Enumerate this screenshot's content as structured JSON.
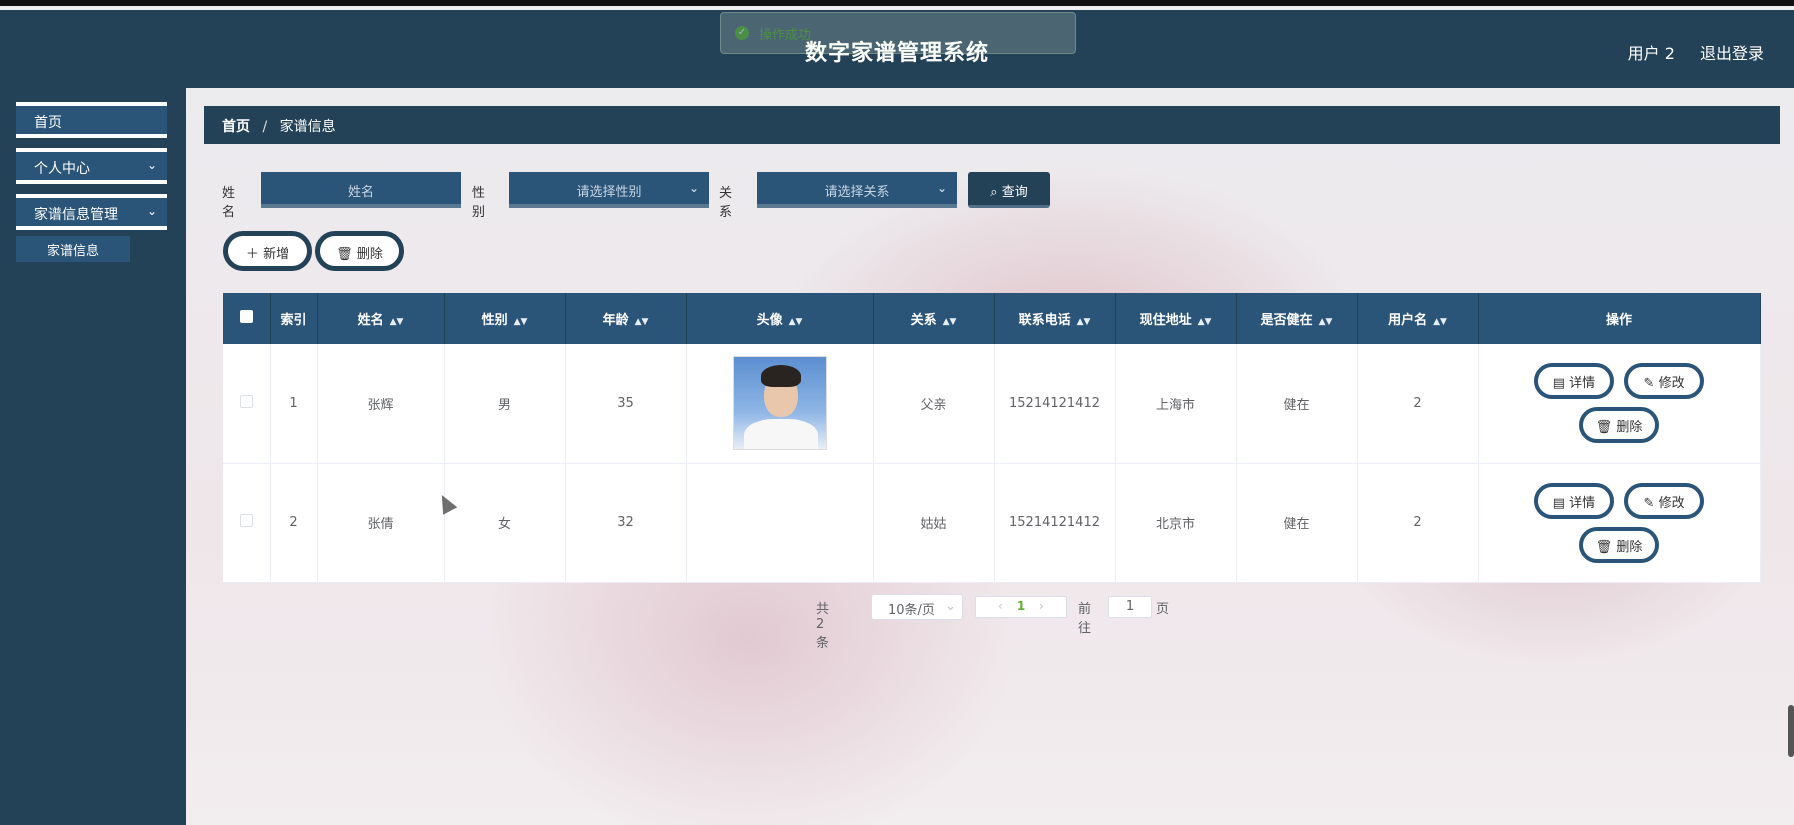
{
  "app_title": "数字家谱管理系统",
  "header_user": "用户 2",
  "header_logout": "退出登录",
  "toast": "操作成功",
  "sidebar": {
    "items": [
      {
        "label": "首页"
      },
      {
        "label": "个人中心"
      },
      {
        "label": "家谱信息管理"
      }
    ],
    "sub_item": "家谱信息"
  },
  "breadcrumb": {
    "home": "首页",
    "sep": "/",
    "current": "家谱信息"
  },
  "search": {
    "name_label": "姓名",
    "name_placeholder": "姓名",
    "gender_label": "性别",
    "gender_placeholder": "请选择性别",
    "relation_label": "关系",
    "relation_placeholder": "请选择关系",
    "query_button": "查询"
  },
  "actions": {
    "add": "新增",
    "delete": "删除"
  },
  "table": {
    "columns": [
      "索引",
      "姓名",
      "性别",
      "年龄",
      "头像",
      "关系",
      "联系电话",
      "现住地址",
      "是否健在",
      "用户名",
      "操作"
    ],
    "rows": [
      {
        "index": "1",
        "name": "张辉",
        "gender": "男",
        "age": "35",
        "relation": "父亲",
        "phone": "15214121412",
        "address": "上海市",
        "alive": "健在",
        "username": "2"
      },
      {
        "index": "2",
        "name": "张倩",
        "gender": "女",
        "age": "32",
        "relation": "姑姑",
        "phone": "15214121412",
        "address": "北京市",
        "alive": "健在",
        "username": "2"
      }
    ],
    "op_detail": "详情",
    "op_edit": "修改",
    "op_delete": "删除"
  },
  "pagination": {
    "total": "共 2 条",
    "page_size": "10条/页",
    "current_page": "1",
    "goto_label": "前往",
    "goto_value": "1",
    "page_suffix": "页"
  },
  "colors": {
    "primary": "#234157",
    "accent": "#2b5479",
    "success": "#67c23a"
  }
}
